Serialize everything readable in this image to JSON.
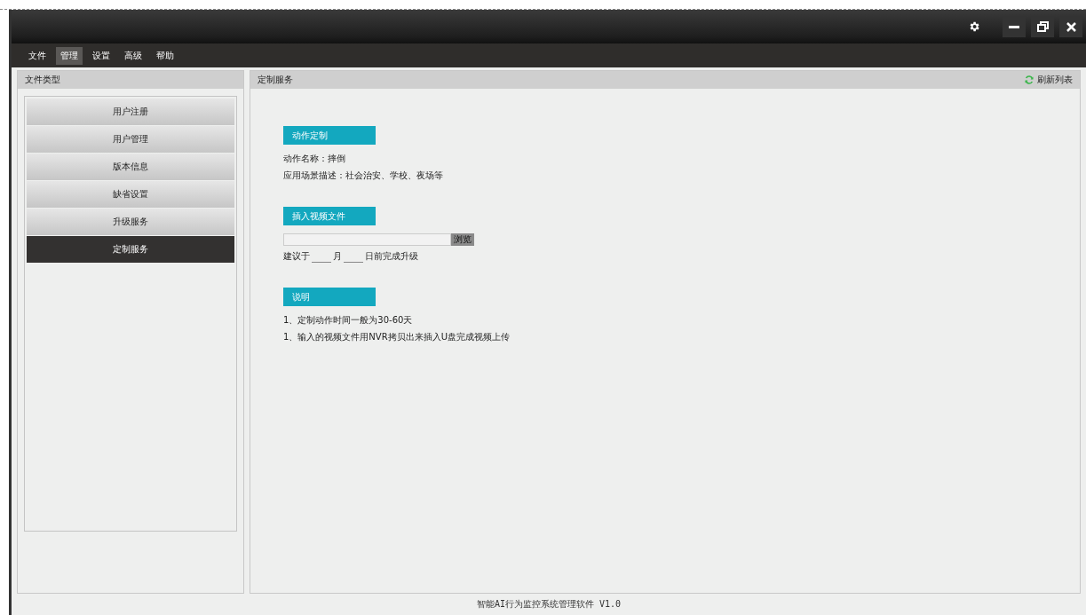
{
  "menu": [
    {
      "label": "文件",
      "selected": false
    },
    {
      "label": "管理",
      "selected": true
    },
    {
      "label": "设置",
      "selected": false
    },
    {
      "label": "高级",
      "selected": false
    },
    {
      "label": "帮助",
      "selected": false
    }
  ],
  "sidebar": {
    "title": "文件类型",
    "items": [
      {
        "label": "用户注册",
        "selected": false
      },
      {
        "label": "用户管理",
        "selected": false
      },
      {
        "label": "版本信息",
        "selected": false
      },
      {
        "label": "缺省设置",
        "selected": false
      },
      {
        "label": "升级服务",
        "selected": false
      },
      {
        "label": "定制服务",
        "selected": true
      }
    ]
  },
  "panel": {
    "title": "定制服务",
    "refresh": "刷新列表"
  },
  "sections": [
    {
      "kind": "lines",
      "heading": "动作定制",
      "lines": [
        "动作名称：摔倒",
        "应用场景描述：社会治安、学校、夜场等"
      ]
    },
    {
      "kind": "file",
      "heading": "插入视频文件",
      "browse": "浏览",
      "schedule": [
        "建议于",
        "月",
        "日前完成升级"
      ]
    },
    {
      "kind": "lines",
      "heading": "说明",
      "lines": [
        "1、定制动作时间一般为30-60天",
        "1、输入的视频文件用NVR拷贝出来插入U盘完成视频上传"
      ]
    }
  ],
  "status_bar": "智能AI行为监控系统管理软件 V1.0"
}
